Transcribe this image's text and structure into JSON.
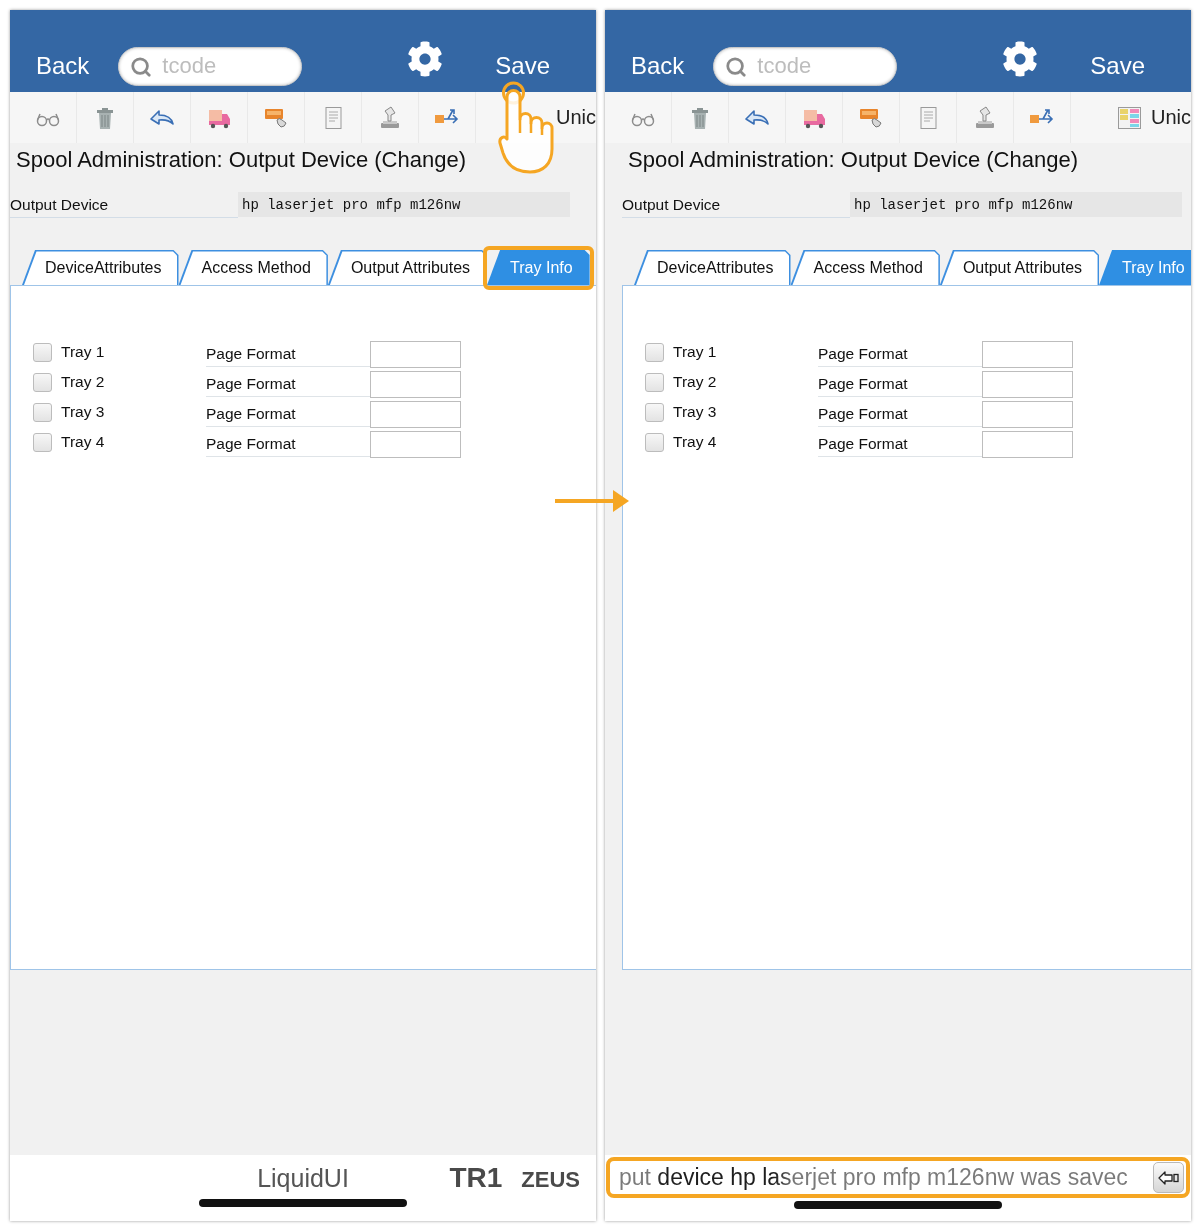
{
  "screens": [
    {
      "header": {
        "back": "Back",
        "search": {
          "placeholder": "tcode"
        },
        "save": {
          "label": "Save",
          "tapped": true
        }
      },
      "toolbar": {
        "trailing_label": "Unic"
      },
      "title": "Spool Administration: Output Device (Change)",
      "output_device": {
        "label": "Output Device",
        "value": "hp laserjet pro mfp m126nw"
      },
      "tabs": [
        {
          "label": "DeviceAttributes",
          "selected": false,
          "highlighted": false
        },
        {
          "label": "Access Method",
          "selected": false,
          "highlighted": false
        },
        {
          "label": "Output Attributes",
          "selected": false,
          "highlighted": false
        },
        {
          "label": "Tray Info",
          "selected": true,
          "highlighted": true
        }
      ],
      "trays": [
        {
          "label": "Tray 1",
          "checked": false,
          "field_label": "Page Format"
        },
        {
          "label": "Tray 2",
          "checked": false,
          "field_label": "Page Format"
        },
        {
          "label": "Tray 3",
          "checked": false,
          "field_label": "Page Format"
        },
        {
          "label": "Tray 4",
          "checked": false,
          "field_label": "Page Format"
        }
      ],
      "footer": {
        "kind": "branding",
        "brand": "LiquidUI",
        "system": "TR1",
        "server": "ZEUS"
      }
    },
    {
      "header": {
        "back": "Back",
        "search": {
          "placeholder": "tcode"
        },
        "save": {
          "label": "Save",
          "tapped": false
        }
      },
      "toolbar": {
        "trailing_label": "Unic"
      },
      "title": "Spool Administration: Output Device (Change)",
      "output_device": {
        "label": "Output Device",
        "value": "hp laserjet pro mfp m126nw"
      },
      "tabs": [
        {
          "label": "DeviceAttributes",
          "selected": false,
          "highlighted": false
        },
        {
          "label": "Access Method",
          "selected": false,
          "highlighted": false
        },
        {
          "label": "Output Attributes",
          "selected": false,
          "highlighted": false
        },
        {
          "label": "Tray Info",
          "selected": true,
          "highlighted": false
        }
      ],
      "trays": [
        {
          "label": "Tray 1",
          "checked": false,
          "field_label": "Page Format"
        },
        {
          "label": "Tray 2",
          "checked": false,
          "field_label": "Page Format"
        },
        {
          "label": "Tray 3",
          "checked": false,
          "field_label": "Page Format"
        },
        {
          "label": "Tray 4",
          "checked": false,
          "field_label": "Page Format"
        }
      ],
      "footer": {
        "kind": "message",
        "message": "put device hp laserjet pro mfp m126nw was savec",
        "highlighted": true
      }
    }
  ]
}
